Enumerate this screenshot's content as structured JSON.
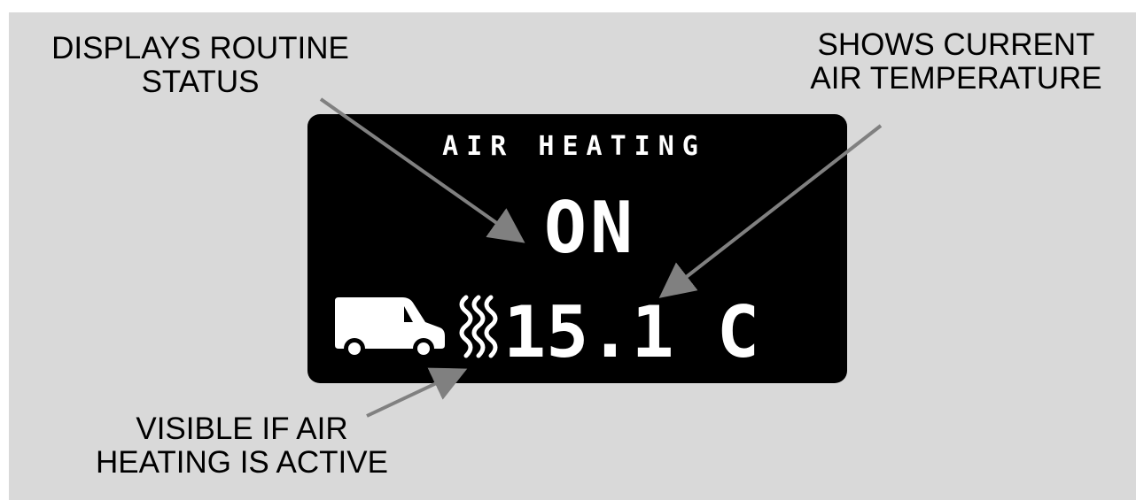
{
  "callouts": {
    "routine_status": [
      "DISPLAYS ROUTINE",
      "STATUS"
    ],
    "air_temperature": [
      "SHOWS CURRENT",
      "AIR TEMPERATURE"
    ],
    "heating_active": [
      "VISIBLE IF AIR",
      "HEATING IS ACTIVE"
    ]
  },
  "display": {
    "title": "AIR HEATING",
    "status": "ON",
    "temperature": "15.1 C"
  },
  "icons": {
    "vehicle": "van-icon",
    "heating": "heat-waves-icon"
  },
  "colors": {
    "background_panel": "#d9d9d9",
    "screen": "#000000",
    "screen_text": "#ffffff",
    "arrow": "#808080"
  }
}
